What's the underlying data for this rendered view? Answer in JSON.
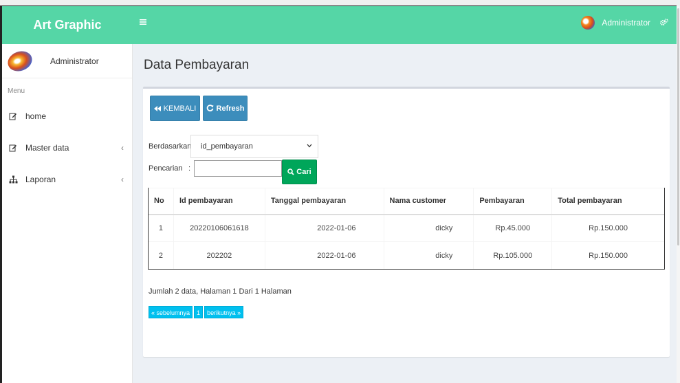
{
  "app": {
    "title": "Art Graphic",
    "brand_color": "#55d6a6"
  },
  "topbar": {
    "user": "Administrator",
    "menu_icon": "bars-icon",
    "settings_icon": "gears-icon"
  },
  "sidebar": {
    "user": "Administrator",
    "menu_header": "Menu",
    "items": [
      {
        "label": "home",
        "icon": "edit-icon",
        "has_submenu": false
      },
      {
        "label": "Master data",
        "icon": "edit-icon",
        "has_submenu": true,
        "chevron": "‹"
      },
      {
        "label": "Laporan",
        "icon": "sitemap-icon",
        "has_submenu": true,
        "chevron": "‹"
      }
    ]
  },
  "page": {
    "title": "Data Pembayaran"
  },
  "toolbar": {
    "back_label": "KEMBALI",
    "refresh_label": "Refresh"
  },
  "filter": {
    "by_label": "Berdasarkan:",
    "by_value": "id_pembayaran",
    "search_label": "Pencarian",
    "search_sep": ":",
    "search_value": "",
    "search_button": "Cari"
  },
  "table": {
    "headers": [
      "No",
      "Id pembayaran",
      "Tanggal pembayaran",
      "Nama customer",
      "Pembayaran",
      "Total pembayaran"
    ],
    "rows": [
      [
        "1",
        "20220106061618",
        "2022-01-06",
        "dicky",
        "Rp.45.000",
        "Rp.150.000"
      ],
      [
        "2",
        "202202",
        "2022-01-06",
        "dicky",
        "Rp.105.000",
        "Rp.150.000"
      ]
    ]
  },
  "summary": "Jumlah 2 data, Halaman 1 Dari 1 Halaman",
  "pagination": {
    "prev": "« sebelumnya",
    "current": "1",
    "next": "berikutnya »"
  }
}
